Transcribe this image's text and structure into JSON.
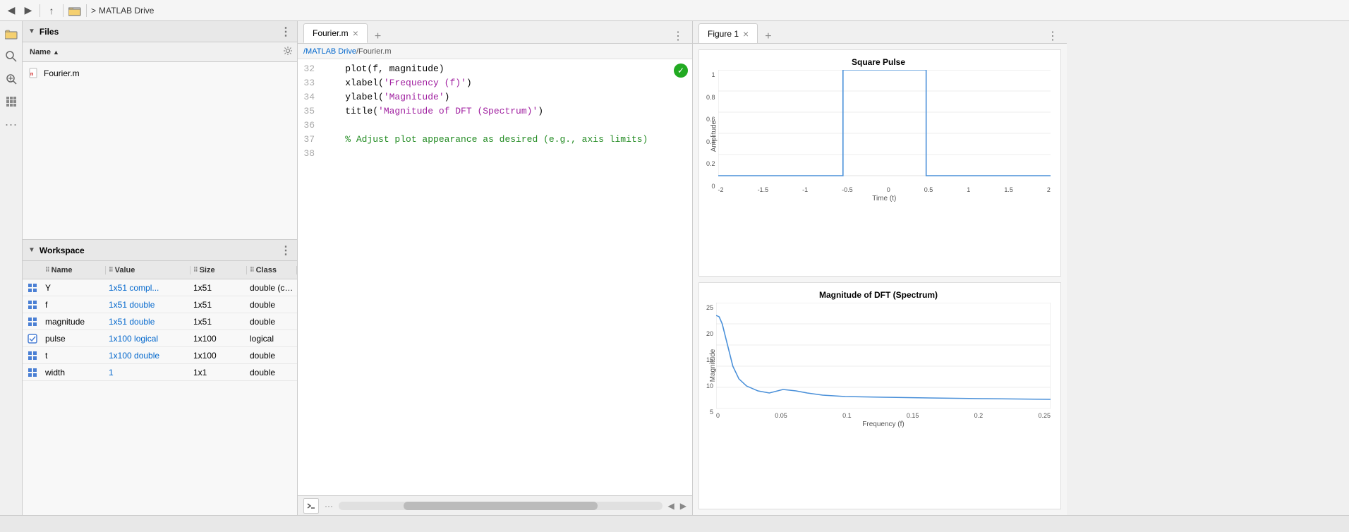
{
  "toolbar": {
    "title": "MATLAB Drive",
    "path_sep1": "/",
    "path_sep2": ">",
    "breadcrumb": "MATLAB Drive"
  },
  "files_section": {
    "title": "Files",
    "name_col": "Name",
    "sort_arrow": "▲",
    "items": [
      {
        "name": "Fourier.m",
        "icon": "m-file"
      }
    ]
  },
  "workspace_section": {
    "title": "Workspace",
    "cols": [
      "",
      "Name",
      "Value",
      "Size",
      "Class"
    ],
    "rows": [
      {
        "icon": "grid",
        "name": "Y",
        "value": "1x51 compl...",
        "size": "1x51",
        "class": "double (com..."
      },
      {
        "icon": "grid",
        "name": "f",
        "value": "1x51 double",
        "size": "1x51",
        "class": "double"
      },
      {
        "icon": "grid",
        "name": "magnitude",
        "value": "1x51 double",
        "size": "1x51",
        "class": "double"
      },
      {
        "icon": "check",
        "name": "pulse",
        "value": "1x100 logical",
        "size": "1x100",
        "class": "logical"
      },
      {
        "icon": "grid",
        "name": "t",
        "value": "1x100 double",
        "size": "1x100",
        "class": "double"
      },
      {
        "icon": "grid",
        "name": "width",
        "value": "1",
        "size": "1x1",
        "class": "double"
      }
    ]
  },
  "editor": {
    "tab_label": "Fourier.m",
    "tab_close": "×",
    "tab_add": "+",
    "path": "/MATLAB Drive/Fourier.m",
    "lines": [
      {
        "num": "32",
        "code": "    plot(f, magnitude)"
      },
      {
        "num": "33",
        "code": "    xlabel('Frequency (f)')"
      },
      {
        "num": "34",
        "code": "    ylabel('Magnitude')"
      },
      {
        "num": "35",
        "code": "    title('Magnitude of DFT (Spectrum)')"
      },
      {
        "num": "36",
        "code": ""
      },
      {
        "num": "37",
        "code": "    % Adjust plot appearance as desired (e.g., axis limits)"
      },
      {
        "num": "38",
        "code": ""
      }
    ]
  },
  "figure": {
    "tab_label": "Figure 1",
    "tab_close": "×",
    "tab_add": "+",
    "plot1": {
      "title": "Square Pulse",
      "xlabel": "Time (t)",
      "ylabel": "Amplitude",
      "y_ticks": [
        "0",
        "0.2",
        "0.4",
        "0.6",
        "0.8",
        "1"
      ],
      "x_ticks": [
        "-2",
        "-1.5",
        "-1",
        "-0.5",
        "0",
        "0.5",
        "1",
        "1.5",
        "2"
      ]
    },
    "plot2": {
      "title": "Magnitude of DFT (Spectrum)",
      "xlabel": "Frequency (f)",
      "ylabel": "Magnitude",
      "y_ticks": [
        "5",
        "10",
        "15",
        "20",
        "25"
      ],
      "x_ticks": [
        "0",
        "0.05",
        "0.1",
        "0.15",
        "0.2",
        "0.25"
      ]
    }
  },
  "sidebar_icons": [
    "folder-icon",
    "search-icon",
    "zoom-icon",
    "grid3-icon",
    "dots-icon"
  ],
  "status_bar": {
    "text": ""
  }
}
